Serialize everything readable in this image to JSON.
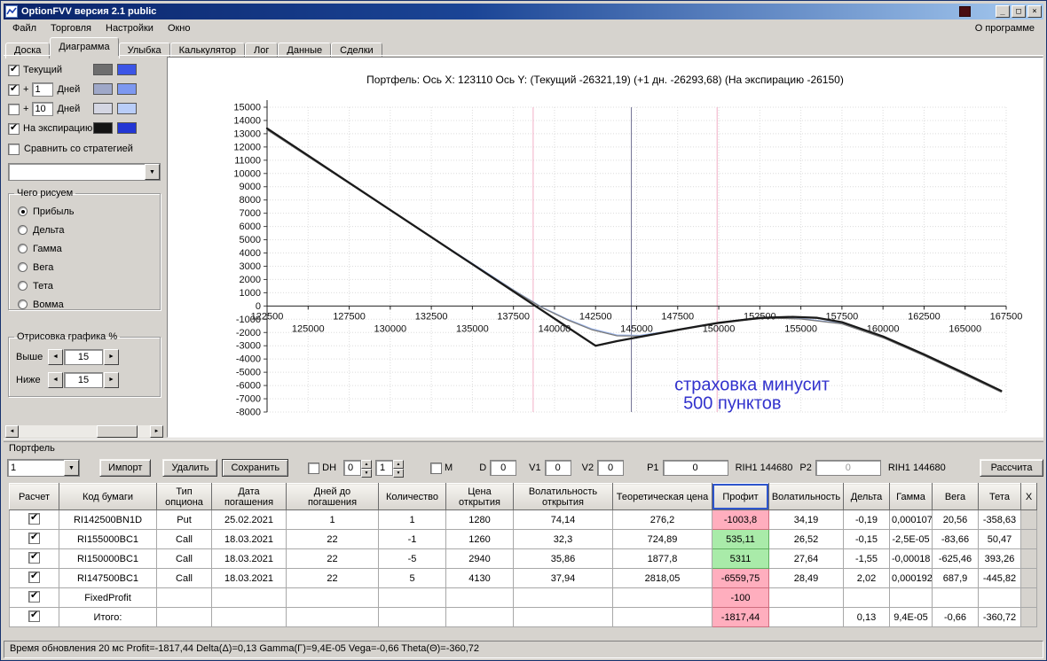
{
  "window": {
    "title": "OptionFVV версия 2.1 public",
    "minimize_glyph": "_",
    "maximize_glyph": "□",
    "close_glyph": "×"
  },
  "menu": {
    "items": [
      "Файл",
      "Торговля",
      "Настройки",
      "Окно"
    ],
    "right_item": "О программе"
  },
  "tabs": {
    "items": [
      "Доска",
      "Диаграмма",
      "Улыбка",
      "Калькулятор",
      "Лог",
      "Данные",
      "Сделки"
    ],
    "active": "Диаграмма"
  },
  "left_panel": {
    "series_rows": [
      {
        "checked": true,
        "plus": "",
        "input": "",
        "label": "Текущий",
        "swatch1": "#6e6e6e",
        "swatch2": "#3c55e6"
      },
      {
        "checked": true,
        "plus": "+",
        "input": "1",
        "label": "Дней",
        "swatch1": "#9fa8c8",
        "swatch2": "#7d98f0"
      },
      {
        "checked": false,
        "plus": "+",
        "input": "10",
        "label": "Дней",
        "swatch1": "#d4d6e2",
        "swatch2": "#b9cdf8"
      },
      {
        "checked": true,
        "plus": "",
        "input": "",
        "label": "На экспирацию",
        "swatch1": "#141414",
        "swatch2": "#2236d4"
      }
    ],
    "compare": {
      "checked": false,
      "label": "Сравнить со стратегией"
    },
    "strategy_combo_value": "",
    "draw_group": {
      "title": "Чего рисуем",
      "selected": "Прибыль",
      "options": [
        "Прибыль",
        "Дельта",
        "Гамма",
        "Вега",
        "Тета",
        "Вомма"
      ]
    },
    "render_group": {
      "title": "Отрисовка графика %",
      "rows": [
        {
          "label": "Выше",
          "value": "15"
        },
        {
          "label": "Ниже",
          "value": "15"
        }
      ]
    }
  },
  "chart_data": {
    "type": "line",
    "title": "Портфель: Ось X: 123110 Ось Y:  (Текущий -26321,19)  (+1 дн. -26293,68)  (На экспирацию -26150)",
    "x_range": [
      122500,
      167500
    ],
    "y_range": [
      -8000,
      15000
    ],
    "y_tick_step": 1000,
    "x_ticks_row1": [
      122500,
      127500,
      132500,
      137500,
      142500,
      147500,
      152500,
      157500,
      162500,
      167500
    ],
    "x_ticks_row2": [
      125000,
      130000,
      135000,
      140000,
      145000,
      150000,
      155000,
      160000,
      165000
    ],
    "grid": true,
    "vlines": [
      {
        "name": "range-low",
        "x": 138700,
        "color": "#f2afc6"
      },
      {
        "name": "range-high",
        "x": 149900,
        "color": "#f2afc6"
      },
      {
        "name": "futures-price",
        "x": 144680,
        "color": "#6f6f92"
      }
    ],
    "series": [
      {
        "name": "+1 дн.",
        "color": "#98b4ee",
        "width": 1.1,
        "points": [
          [
            122500,
            13350
          ],
          [
            127500,
            9280
          ],
          [
            132500,
            5220
          ],
          [
            137500,
            1220
          ],
          [
            139200,
            -60
          ],
          [
            140800,
            -1000
          ],
          [
            142300,
            -1730
          ],
          [
            143800,
            -2180
          ],
          [
            145200,
            -2210
          ],
          [
            147000,
            -1890
          ],
          [
            149000,
            -1440
          ],
          [
            151000,
            -1080
          ],
          [
            153000,
            -860
          ],
          [
            155000,
            -940
          ],
          [
            157500,
            -1300
          ],
          [
            160000,
            -2350
          ],
          [
            162500,
            -3700
          ],
          [
            165000,
            -5150
          ],
          [
            167200,
            -6450
          ]
        ]
      },
      {
        "name": "Текущий",
        "color": "#7a7a7a",
        "width": 1.3,
        "points": [
          [
            122500,
            13300
          ],
          [
            125000,
            11270
          ],
          [
            127500,
            9240
          ],
          [
            130000,
            7210
          ],
          [
            132500,
            5180
          ],
          [
            135000,
            3160
          ],
          [
            137500,
            1180
          ],
          [
            139200,
            -100
          ],
          [
            140800,
            -1050
          ],
          [
            142300,
            -1800
          ],
          [
            143800,
            -2250
          ],
          [
            145200,
            -2280
          ],
          [
            147000,
            -1950
          ],
          [
            149000,
            -1500
          ],
          [
            151000,
            -1130
          ],
          [
            153000,
            -900
          ],
          [
            155000,
            -980
          ],
          [
            157500,
            -1350
          ],
          [
            160000,
            -2400
          ],
          [
            162500,
            -3750
          ],
          [
            165000,
            -5200
          ],
          [
            167200,
            -6500
          ]
        ]
      },
      {
        "name": "На экспирацию",
        "color": "#1a1a1a",
        "width": 2.3,
        "points": [
          [
            122500,
            13400
          ],
          [
            125000,
            11350
          ],
          [
            127500,
            9300
          ],
          [
            130000,
            7250
          ],
          [
            132500,
            5200
          ],
          [
            135000,
            3150
          ],
          [
            137500,
            1100
          ],
          [
            140000,
            -950
          ],
          [
            142500,
            -3000
          ],
          [
            143800,
            -2650
          ],
          [
            145000,
            -2380
          ],
          [
            147500,
            -1800
          ],
          [
            150000,
            -1270
          ],
          [
            152500,
            -900
          ],
          [
            154500,
            -820
          ],
          [
            156000,
            -890
          ],
          [
            157500,
            -1220
          ],
          [
            160000,
            -2300
          ],
          [
            162500,
            -3650
          ],
          [
            165000,
            -5100
          ],
          [
            167200,
            -6400
          ]
        ]
      }
    ],
    "annotation": {
      "x": 147300,
      "y1": -6350,
      "y2": -7750,
      "line1": "страховка минусит",
      "line2": "500 пунктов",
      "color": "#3232cd"
    }
  },
  "portfolio": {
    "caption": "Портфель",
    "toolbar": {
      "portfolio_select": "1",
      "import_button": "Импорт",
      "delete_button": "Удалить",
      "save_button": "Сохранить",
      "dh": {
        "checked": false,
        "label": "DH"
      },
      "spin_a": "0",
      "spin_b": "1",
      "m": {
        "checked": false,
        "label": "М"
      },
      "d": {
        "label": "D",
        "value": "0"
      },
      "v1": {
        "label": "V1",
        "value": "0"
      },
      "v2": {
        "label": "V2",
        "value": "0"
      },
      "p1": {
        "label": "P1",
        "value": "0"
      },
      "rih1_left": "RIH1 144680",
      "p2": {
        "label": "P2",
        "value": "0"
      },
      "rih1_right": "RIH1 144680",
      "calc_button": "Рассчита"
    },
    "table": {
      "headers": [
        "Расчет",
        "Код бумаги",
        "Тип опциона",
        "Дата погашения",
        "Дней до погашения",
        "Количество",
        "Цена открытия",
        "Волатильность открытия",
        "Теоретическая цена",
        "Профит",
        "Волатильность",
        "Дельта",
        "Гамма",
        "Вега",
        "Тета",
        "X"
      ],
      "rows": [
        {
          "checked": true,
          "code": "RI142500BN1D",
          "type": "Put",
          "date": "25.02.2021",
          "days": "1",
          "qty": "1",
          "price": "1280",
          "vol_open": "74,14",
          "theo": "276,2",
          "profit": "-1003,8",
          "profit_sign": "neg",
          "vol": "34,19",
          "delta": "-0,19",
          "gamma": "0,000107",
          "vega": "20,56",
          "theta": "-358,63"
        },
        {
          "checked": true,
          "code": "RI155000BC1",
          "type": "Call",
          "date": "18.03.2021",
          "days": "22",
          "qty": "-1",
          "price": "1260",
          "vol_open": "32,3",
          "theo": "724,89",
          "profit": "535,11",
          "profit_sign": "pos",
          "vol": "26,52",
          "delta": "-0,15",
          "gamma": "-2,5E-05",
          "vega": "-83,66",
          "theta": "50,47"
        },
        {
          "checked": true,
          "code": "RI150000BC1",
          "type": "Call",
          "date": "18.03.2021",
          "days": "22",
          "qty": "-5",
          "price": "2940",
          "vol_open": "35,86",
          "theo": "1877,8",
          "profit": "5311",
          "profit_sign": "pos",
          "vol": "27,64",
          "delta": "-1,55",
          "gamma": "-0,00018",
          "vega": "-625,46",
          "theta": "393,26"
        },
        {
          "checked": true,
          "code": "RI147500BC1",
          "type": "Call",
          "date": "18.03.2021",
          "days": "22",
          "qty": "5",
          "price": "4130",
          "vol_open": "37,94",
          "theo": "2818,05",
          "profit": "-6559,75",
          "profit_sign": "neg",
          "vol": "28,49",
          "delta": "2,02",
          "gamma": "0,000192",
          "vega": "687,9",
          "theta": "-445,82"
        },
        {
          "checked": true,
          "code": "FixedProfit",
          "type": "",
          "date": "",
          "days": "",
          "qty": "",
          "price": "",
          "vol_open": "",
          "theo": "",
          "profit": "-100",
          "profit_sign": "neg",
          "vol": "",
          "delta": "",
          "gamma": "",
          "vega": "",
          "theta": ""
        },
        {
          "checked": true,
          "code": "Итого:",
          "type": "",
          "date": "",
          "days": "",
          "qty": "",
          "price": "",
          "vol_open": "",
          "theo": "",
          "profit": "-1817,44",
          "profit_sign": "neg",
          "vol": "",
          "delta": "0,13",
          "gamma": "9,4E-05",
          "vega": "-0,66",
          "theta": "-360,72"
        }
      ]
    }
  },
  "statusbar": {
    "text": "Время обновления 20 мс   Profit=-1817,44 Delta(Δ)=0,13 Gamma(Γ)=9,4E-05 Vega=-0,66 Theta(Θ)=-360,72"
  },
  "icons": {
    "dropdown_arrow": "▼",
    "spin_up": "▲",
    "spin_down": "▼",
    "scroll_left": "◄",
    "scroll_right": "►"
  }
}
